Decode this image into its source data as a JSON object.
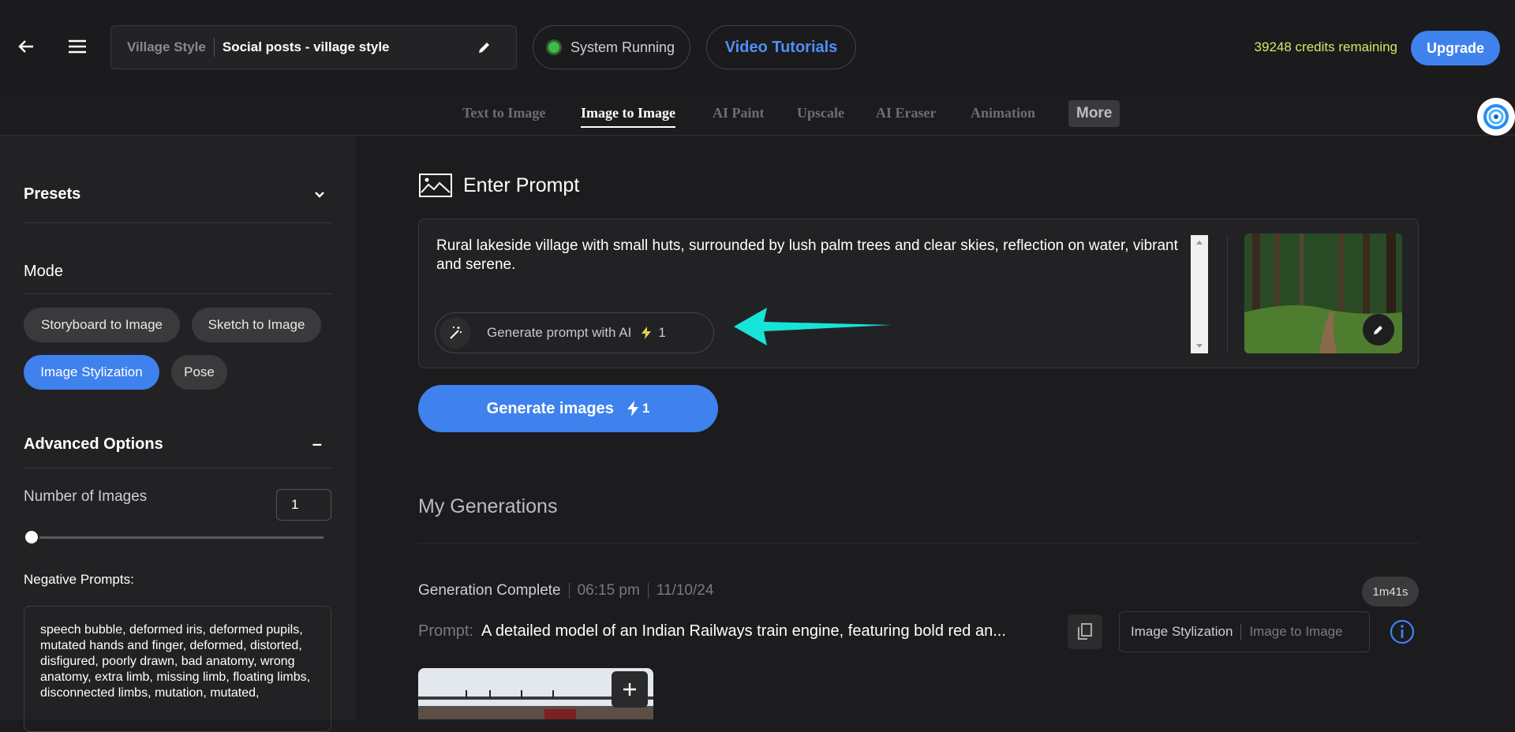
{
  "header": {
    "project_crumb": "Village Style",
    "project_name": "Social posts - village style",
    "status_text": "System Running",
    "tutorials_label": "Video Tutorials",
    "credits_text": "39248 credits remaining",
    "upgrade_label": "Upgrade"
  },
  "tabs": [
    "Text to Image",
    "Image to Image",
    "AI Paint",
    "Upscale",
    "AI Eraser",
    "Animation",
    "More"
  ],
  "sidebar": {
    "presets_label": "Presets",
    "mode_label": "Mode",
    "modes": [
      "Storyboard to Image",
      "Sketch to Image",
      "Image Stylization",
      "Pose"
    ],
    "advanced_label": "Advanced Options",
    "advanced_toggle": "–",
    "num_images_label": "Number of Images",
    "num_images_value": "1",
    "slider_value": 1,
    "negative_label": "Negative Prompts:",
    "negative_text": "speech bubble, deformed iris, deformed pupils, mutated hands and finger, deformed, distorted, disfigured, poorly drawn, bad anatomy, wrong anatomy, extra limb, missing limb, floating limbs, disconnected limbs, mutation, mutated,"
  },
  "prompt": {
    "heading": "Enter Prompt",
    "text": "Rural lakeside village with small huts, surrounded by lush palm trees and clear skies, reflection on water, vibrant and serene.",
    "gen_ai_label": "Generate prompt with AI",
    "gen_ai_cost": "1",
    "generate_label": "Generate images",
    "generate_cost": "1"
  },
  "generations": {
    "heading": "My Generations",
    "status": "Generation Complete",
    "time": "06:15 pm",
    "date": "11/10/24",
    "duration": "1m41s",
    "prompt_label": "Prompt:",
    "prompt_text": "A detailed model of an Indian Railways train engine, featuring bold red an...",
    "tag1": "Image Stylization",
    "tag2": "Image to Image"
  },
  "colors": {
    "accent": "#3f82ee",
    "credits": "#d9e56a",
    "arrow": "#16e4d8",
    "status": "#3dbb48"
  }
}
